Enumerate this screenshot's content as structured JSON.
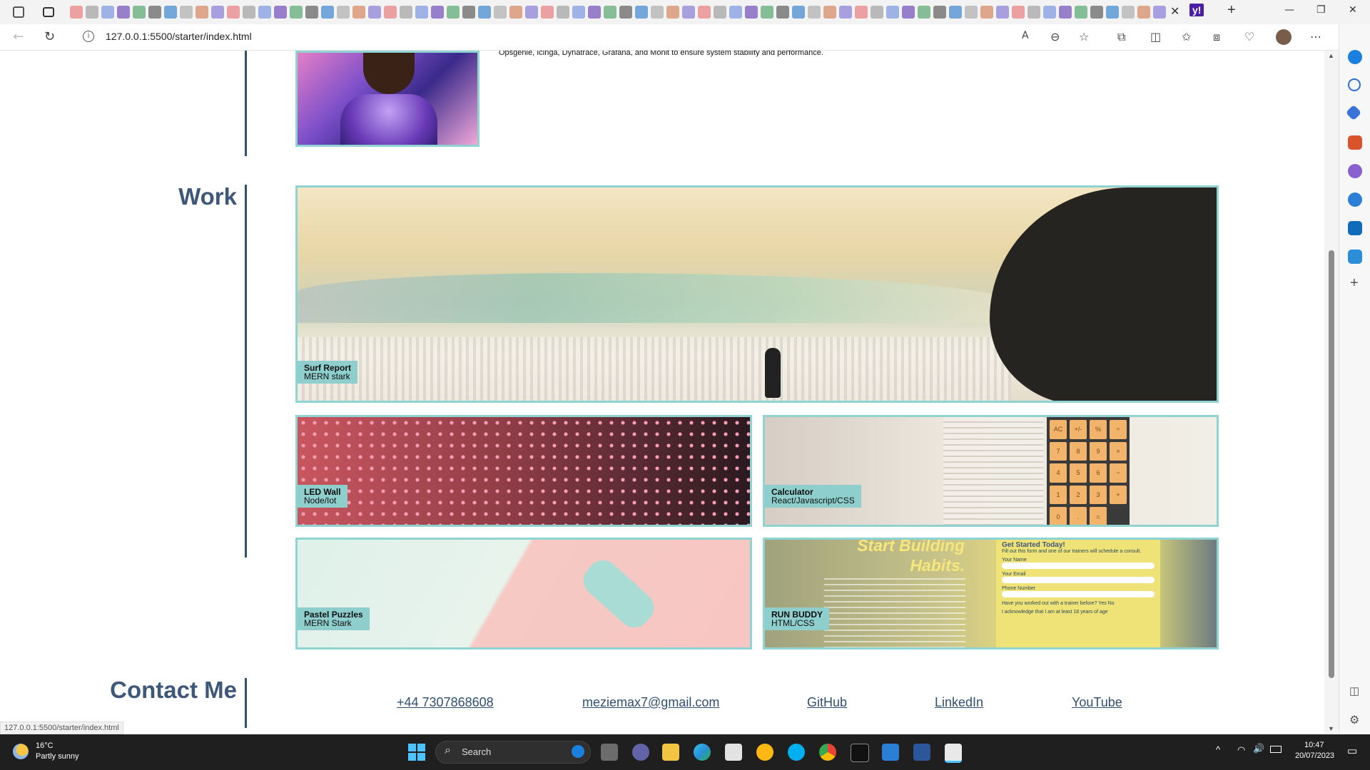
{
  "browser": {
    "url": "127.0.0.1:5500/starter/index.html",
    "status_url": "127.0.0.1:5500/starter/index.html",
    "read_aloud_label": "A",
    "window_controls": {
      "minimize": "—",
      "restore": "❐",
      "close": "✕"
    }
  },
  "page": {
    "intro_text": "Opsgenie, Icinga, Dynatrace, Grafana, and Monit to ensure system stability and performance.",
    "work": {
      "title": "Work",
      "projects": [
        {
          "name": "Surf Report",
          "stack": "MERN stark"
        },
        {
          "name": "LED Wall",
          "stack": "Node/Iot"
        },
        {
          "name": "Calculator",
          "stack": "React/Javascript/CSS"
        },
        {
          "name": "Pastel Puzzles",
          "stack": "MERN Stark"
        },
        {
          "name": "RUN BUDDY",
          "stack": "HTML/CSS"
        }
      ],
      "run_buddy_preview": {
        "headline_1": "Start Building",
        "headline_2": "Habits.",
        "form_title": "Get Started Today!",
        "form_sub": "Fill out this form and one of our trainers will schedule a consult.",
        "field_name": "Your Name",
        "field_email": "Your Email",
        "field_phone": "Phone Number",
        "question": "Have you worked out with a trainer before?",
        "yes": "Yes",
        "no": "No",
        "acknowledge": "I acknowledge that I am at least 18 years of age"
      },
      "calculator_preview": {
        "keys": [
          "AC",
          "+/-",
          "%",
          "÷",
          "7",
          "8",
          "9",
          "×",
          "4",
          "5",
          "6",
          "−",
          "1",
          "2",
          "3",
          "+",
          "0",
          ".",
          "="
        ]
      }
    },
    "contact": {
      "title": "Contact Me",
      "phone": "+44 7307868608",
      "email": "meziemax7@gmail.com",
      "github": "GitHub",
      "linkedin": "LinkedIn",
      "youtube": "YouTube"
    }
  },
  "taskbar": {
    "weather_temp": "16°C",
    "weather_desc": "Partly sunny",
    "search_placeholder": "Search",
    "time": "10:47",
    "date": "20/07/2023"
  },
  "colors": {
    "accent_teal": "#8fd3d2",
    "heading_navy": "#3e5879",
    "line_navy": "#2f4f73"
  }
}
